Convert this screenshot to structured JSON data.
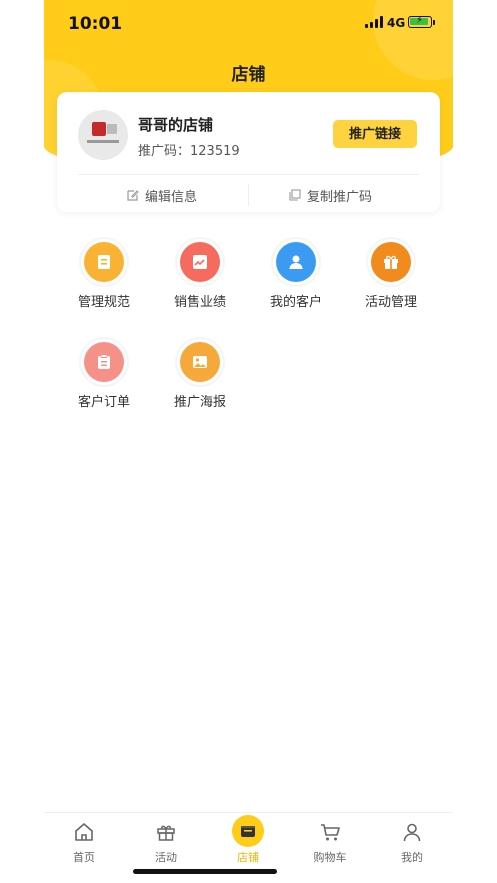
{
  "status_bar": {
    "time": "10:01",
    "network": "4G"
  },
  "header": {
    "title": "店铺"
  },
  "shop": {
    "name": "哥哥的店铺",
    "promo_code": "推广码：123519",
    "promo_link_button": "推广链接",
    "edit_info": "编辑信息",
    "copy_promo_code": "复制推广码"
  },
  "menu": {
    "items": [
      {
        "label": "管理规范",
        "icon": "document-icon",
        "color": "#f9b233"
      },
      {
        "label": "销售业绩",
        "icon": "trend-chart-icon",
        "color": "#f56c5e"
      },
      {
        "label": "我的客户",
        "icon": "customer-icon",
        "color": "#3a9bf0"
      },
      {
        "label": "活动管理",
        "icon": "gift-icon",
        "color": "#f28b1e"
      },
      {
        "label": "客户订单",
        "icon": "clipboard-icon",
        "color": "#f6918a"
      },
      {
        "label": "推广海报",
        "icon": "image-icon",
        "color": "#f7a83a"
      }
    ]
  },
  "tabbar": {
    "items": [
      {
        "label": "首页",
        "icon": "home-icon"
      },
      {
        "label": "活动",
        "icon": "gift-icon"
      },
      {
        "label": "店铺",
        "icon": "store-icon",
        "active": true
      },
      {
        "label": "购物车",
        "icon": "cart-icon"
      },
      {
        "label": "我的",
        "icon": "user-icon"
      }
    ]
  },
  "colors": {
    "brand_yellow": "#ffcc1a",
    "button_yellow": "#ffd33f",
    "active_tab": "#f5b400"
  }
}
